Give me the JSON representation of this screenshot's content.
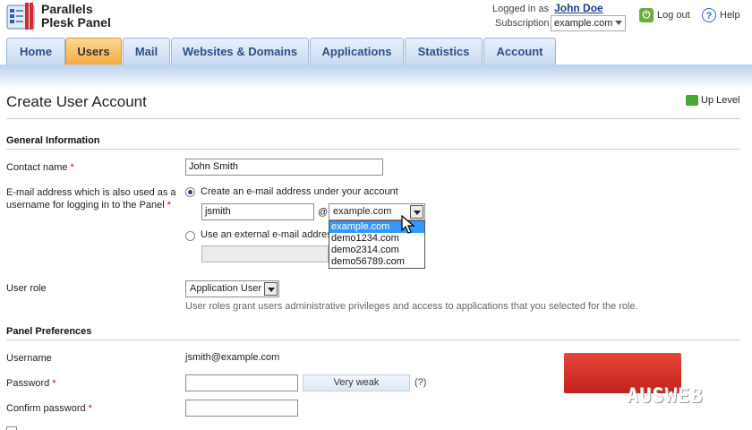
{
  "header": {
    "brand_line1": "Parallels",
    "brand_line2": "Plesk Panel",
    "logged_in_label": "Logged in as",
    "user_name": "John Doe",
    "subscription_label": "Subscription",
    "subscription_value": "example.com",
    "logout_label": "Log out",
    "help_label": "Help"
  },
  "tabs": [
    {
      "label": "Home",
      "active": false
    },
    {
      "label": "Users",
      "active": true
    },
    {
      "label": "Mail",
      "active": false
    },
    {
      "label": "Websites & Domains",
      "active": false
    },
    {
      "label": "Applications",
      "active": false
    },
    {
      "label": "Statistics",
      "active": false
    },
    {
      "label": "Account",
      "active": false
    }
  ],
  "page": {
    "title": "Create User Account",
    "up_level": "Up Level"
  },
  "general": {
    "heading": "General Information",
    "contact_name_label": "Contact name",
    "contact_name_value": "John Smith",
    "email_label_line1": "E-mail address which is also used as a",
    "email_label_line2": "username for logging in to the Panel",
    "option_create": "Create an e-mail address under your account",
    "email_local_value": "jsmith",
    "at_sign": "@",
    "domain_selected": "example.com",
    "option_external": "Use an external e-mail addres",
    "domain_options": [
      "example.com",
      "demo1234.com",
      "demo2314.com",
      "demo56789.com"
    ],
    "user_role_label": "User role",
    "user_role_value": "Application User",
    "user_role_hint": "User roles grant users administrative privileges and access to applications that you selected for the role."
  },
  "prefs": {
    "heading": "Panel Preferences",
    "username_label": "Username",
    "username_value": "jsmith@example.com",
    "password_label": "Password",
    "strength_label": "Very weak",
    "strength_help": "(?)",
    "confirm_label": "Confirm password"
  },
  "watermark": {
    "text": "AUSWEB"
  },
  "colors": {
    "tab_active": "#f3a93b",
    "tab_inactive": "#c6d9f0",
    "link": "#1a3e8a",
    "required": "#dd0000",
    "selection": "#3399ff",
    "watermark": "#c2231c"
  }
}
